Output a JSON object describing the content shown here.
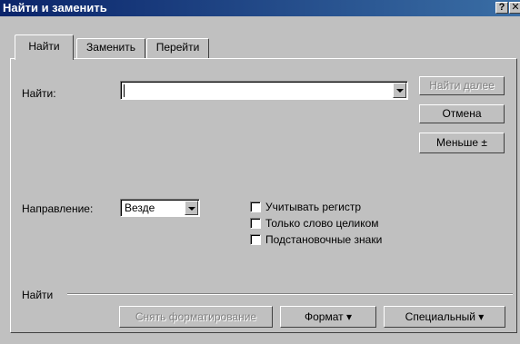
{
  "window": {
    "title": "Найти и заменить",
    "help_label": "?",
    "close_label": "✕"
  },
  "tabs": [
    {
      "label": "Найти",
      "active": true
    },
    {
      "label": "Заменить",
      "active": false
    },
    {
      "label": "Перейти",
      "active": false
    }
  ],
  "find": {
    "label": "Найти:",
    "value": ""
  },
  "buttons": {
    "find_next": "Найти далее",
    "cancel": "Отмена",
    "less": "Меньше ±"
  },
  "direction": {
    "label": "Направление:",
    "value": "Везде"
  },
  "options": [
    {
      "label": "Учитывать регистр",
      "checked": false
    },
    {
      "label": "Только слово целиком",
      "checked": false
    },
    {
      "label": "Подстановочные знаки",
      "checked": false
    }
  ],
  "bottom": {
    "group_label": "Найти",
    "clear_format": "Снять форматирование",
    "format": "Формат ▾",
    "special": "Специальный ▾"
  }
}
